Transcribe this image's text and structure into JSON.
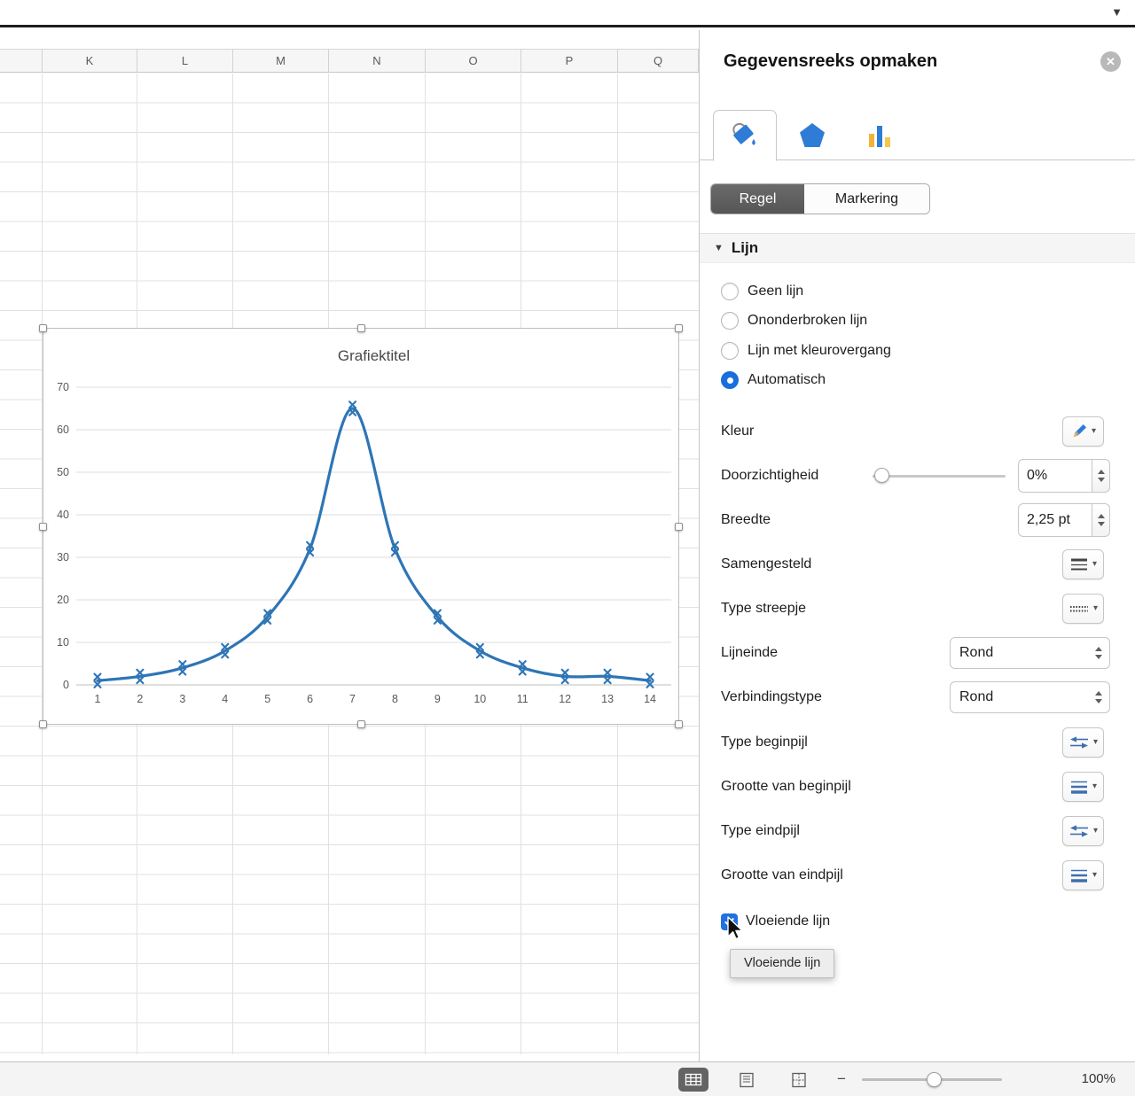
{
  "icons": {
    "window_arrow": "▼",
    "disclosure_down": "▼",
    "caret_down": "▾",
    "close": "✕",
    "zoom_minus": "−"
  },
  "spreadsheet": {
    "columns": [
      "K",
      "L",
      "M",
      "N",
      "O",
      "P",
      "Q"
    ]
  },
  "chart_data": {
    "type": "line",
    "title": "Grafiektitel",
    "x": [
      1,
      2,
      3,
      4,
      5,
      6,
      7,
      8,
      9,
      10,
      11,
      12,
      13,
      14
    ],
    "series": [
      {
        "values": [
          1,
          2,
          4,
          8,
          16,
          32,
          65,
          32,
          16,
          8,
          4,
          2,
          2,
          1
        ]
      }
    ],
    "ylim": [
      0,
      70
    ],
    "yticks": [
      0,
      10,
      20,
      30,
      40,
      50,
      60,
      70
    ],
    "grid": true,
    "smooth": true,
    "marker_style": "x",
    "line_color": "#2e75b6"
  },
  "panel": {
    "title": "Gegevensreeks opmaken",
    "segments": {
      "regel": "Regel",
      "markering": "Markering"
    },
    "section_title": "Lijn",
    "radios": [
      {
        "label": "Geen lijn",
        "selected": false
      },
      {
        "label": "Ononderbroken lijn",
        "selected": false
      },
      {
        "label": "Lijn met kleurovergang",
        "selected": false
      },
      {
        "label": "Automatisch",
        "selected": true
      }
    ],
    "rows": {
      "kleur": {
        "label": "Kleur"
      },
      "doorzichtigheid": {
        "label": "Doorzichtigheid",
        "value": "0%"
      },
      "breedte": {
        "label": "Breedte",
        "value": "2,25 pt"
      },
      "samengesteld": {
        "label": "Samengesteld"
      },
      "type_streepje": {
        "label": "Type streepje"
      },
      "lijneinde": {
        "label": "Lijneinde",
        "value": "Rond"
      },
      "verbindingstype": {
        "label": "Verbindingstype",
        "value": "Rond"
      },
      "type_beginpijl": {
        "label": "Type beginpijl"
      },
      "grootte_beginpijl": {
        "label": "Grootte van beginpijl"
      },
      "type_eindpijl": {
        "label": "Type eindpijl"
      },
      "grootte_eindpijl": {
        "label": "Grootte van eindpijl"
      }
    },
    "smooth_line": {
      "label": "Vloeiende lijn",
      "checked": true
    },
    "tooltip": "Vloeiende lijn"
  },
  "statusbar": {
    "zoom": "100%"
  },
  "colors": {
    "accent_blue": "#2071e1",
    "line_blue": "#2e75b6",
    "icon_blue": "#2e7cd6",
    "bar_yellow": "#f2b33c"
  }
}
